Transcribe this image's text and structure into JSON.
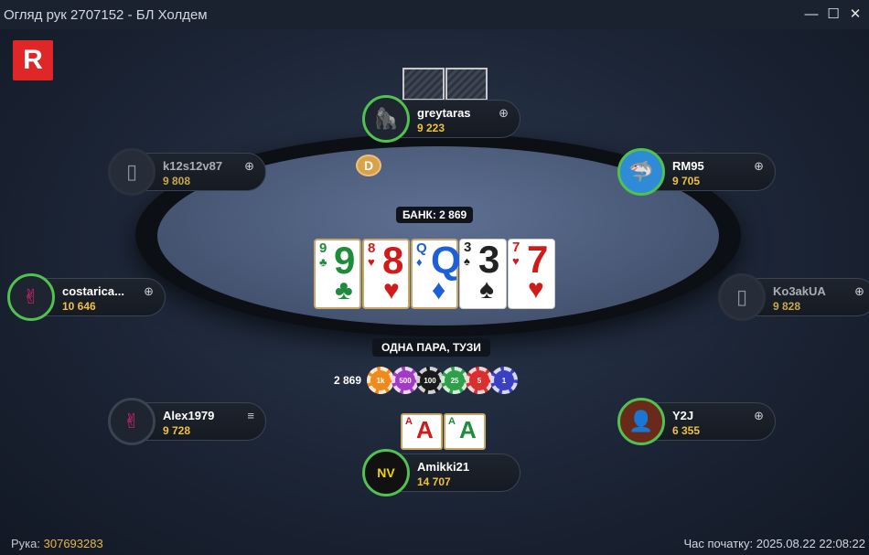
{
  "window": {
    "title": "Огляд рук 2707152 - БЛ Холдем",
    "minimize": "—",
    "maximize": "☐",
    "close": "✕"
  },
  "logo": {
    "letter": "R"
  },
  "table": {
    "dealer": "D",
    "pot": "БАНК: 2 869",
    "hand_description": "ОДНА ПАРА, ТУЗИ",
    "bet_amount": "2 869",
    "chips": [
      {
        "label": "1k",
        "color": "#f08a1c"
      },
      {
        "label": "500",
        "color": "#a03ac7"
      },
      {
        "label": "100",
        "color": "#1a1a1a"
      },
      {
        "label": "25",
        "color": "#2ea04a"
      },
      {
        "label": "5",
        "color": "#d92f2f"
      },
      {
        "label": "1",
        "color": "#3b3fc4"
      }
    ],
    "board": [
      {
        "rank": "9",
        "suit": "♣",
        "color": "#1e8c3a"
      },
      {
        "rank": "8",
        "suit": "♥",
        "color": "#d11b1b"
      },
      {
        "rank": "Q",
        "suit": "♦",
        "color": "#1c5fd6"
      },
      {
        "rank": "3",
        "suit": "♠",
        "color": "#222222"
      },
      {
        "rank": "7",
        "suit": "♥",
        "color": "#d11b1b"
      }
    ]
  },
  "players": {
    "greytaras": {
      "name": "greytaras",
      "stack": "9 223",
      "icon": "plus-circle-icon",
      "glyph": "⊕"
    },
    "rm95": {
      "name": "RM95",
      "stack": "9 705",
      "icon": "plus-circle-icon",
      "glyph": "⊕"
    },
    "k12s12v87": {
      "name": "k12s12v87",
      "stack": "9 808",
      "icon": "plus-circle-icon",
      "glyph": "⊕"
    },
    "costarica": {
      "name": "costarica...",
      "stack": "10 646",
      "icon": "plus-circle-icon",
      "glyph": "⊕"
    },
    "ko3akua": {
      "name": "Ko3akUA",
      "stack": "9 828",
      "icon": "plus-circle-icon",
      "glyph": "⊕"
    },
    "alex1979": {
      "name": "Alex1979",
      "stack": "9 728",
      "icon": "menu-icon",
      "glyph": "≡"
    },
    "y2j": {
      "name": "Y2J",
      "stack": "6 355",
      "icon": "plus-circle-icon",
      "glyph": "⊕"
    },
    "amikki21": {
      "name": "Amikki21",
      "stack": "14 707"
    }
  },
  "hero_cards": [
    {
      "rank": "A",
      "suit": "♥",
      "color": "#d11b1b"
    },
    {
      "rank": "A",
      "suit": "♣",
      "color": "#1e8c3a"
    }
  ],
  "footer": {
    "hand_label": "Рука:",
    "hand_id": "307693283",
    "start_time": "Час початку: 2025.08.22 22:08:22"
  }
}
